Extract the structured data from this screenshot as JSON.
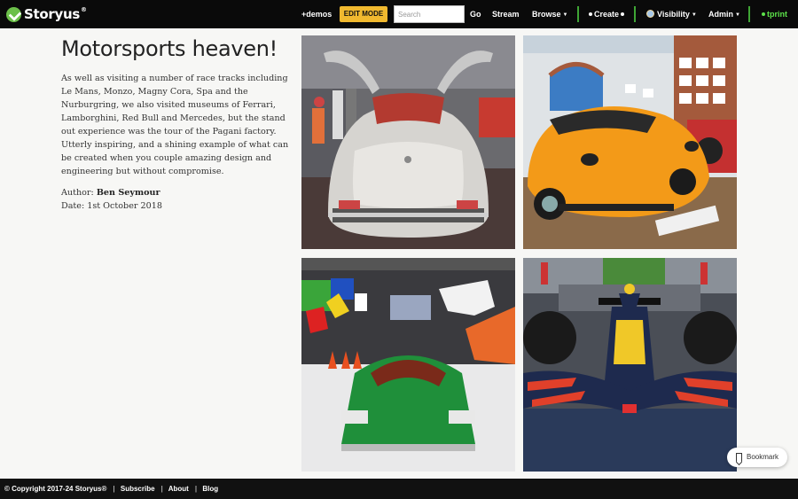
{
  "nav": {
    "logo_text": "Storyus",
    "logo_reg": "®",
    "demos": "+demos",
    "edit_mode": "EDIT MODE",
    "search_placeholder": "Search",
    "go": "Go",
    "stream": "Stream",
    "browse": "Browse",
    "create": "Create",
    "visibility": "Visibility",
    "admin": "Admin",
    "user": "tprint"
  },
  "article": {
    "title": "Motorsports heaven!",
    "body": "As well as visiting a number of race tracks including Le Mans, Monzo, Magny Cora, Spa and the Nurburgring, we also visited museums of Ferrari, Lamborghini, Red Bull and Mercedes, but the stand out experience was the tour of the Pagani factory. Utterly inspiring, and a shining example of what can be created when you couple amazing design and engineering but without compromise.",
    "author_label": "Author:",
    "author_name": "Ben Seymour",
    "date_label": "Date:",
    "date_value": "1st October 2018"
  },
  "photos": [
    {
      "name": "mercedes-gullwing-photo",
      "desc": "silver gullwing car"
    },
    {
      "name": "pagani-zonda-photo",
      "desc": "orange supercar"
    },
    {
      "name": "lamborghini-countach-photo",
      "desc": "green supercar"
    },
    {
      "name": "red-bull-f1-photo",
      "desc": "formula one car"
    }
  ],
  "bookmark": "Bookmark",
  "footer": {
    "copyright": "© Copyright 2017-24 Storyus®",
    "subscribe": "Subscribe",
    "about": "About",
    "blog": "Blog"
  },
  "colors": {
    "accent_green": "#3fa535",
    "edit_mode_bg": "#f1b92f",
    "topbar_bg": "#0a0a0a"
  }
}
